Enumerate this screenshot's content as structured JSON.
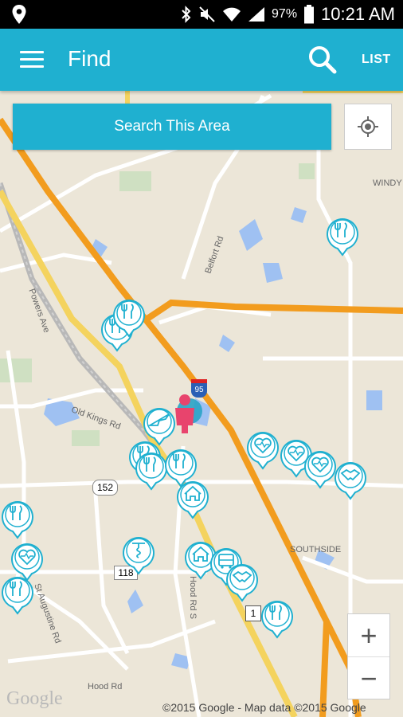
{
  "status_bar": {
    "battery": "97%",
    "time": "10:21 AM",
    "icons": [
      "location-icon",
      "bluetooth-icon",
      "mute-icon",
      "wifi-icon",
      "signal-icon",
      "battery-icon"
    ]
  },
  "app_bar": {
    "title": "Find",
    "list_label": "LIST",
    "color": "#1fb0d0"
  },
  "map": {
    "search_area_label": "Search This Area",
    "zoom_in": "+",
    "zoom_out": "−",
    "google_logo": "Google",
    "copyright": "©2015 Google - Map data ©2015 Google",
    "labels": {
      "windy": "WINDY",
      "belfort": "Belfort Rd",
      "powers": "Powers Ave",
      "old_kings": "Old Kings Rd",
      "southside": "SOUTHSIDE",
      "hood_rd": "Hood Rd S",
      "st_augustine": "St Augustine Rd",
      "hood_rd_bottom": "Hood Rd",
      "rt152": "152",
      "rt118": "118",
      "i95": "95",
      "us1": "1"
    },
    "pins": [
      {
        "type": "restaurant",
        "icon": "restaurant-icon"
      },
      {
        "type": "restaurant",
        "icon": "restaurant-icon"
      },
      {
        "type": "restaurant",
        "icon": "restaurant-icon"
      },
      {
        "type": "airport",
        "icon": "airplane-icon"
      },
      {
        "type": "restaurant",
        "icon": "restaurant-icon"
      },
      {
        "type": "restaurant",
        "icon": "restaurant-icon"
      },
      {
        "type": "restaurant",
        "icon": "restaurant-icon"
      },
      {
        "type": "home",
        "icon": "home-icon"
      },
      {
        "type": "health",
        "icon": "heart-health-icon"
      },
      {
        "type": "health",
        "icon": "heart-health-icon"
      },
      {
        "type": "health",
        "icon": "heart-health-icon"
      },
      {
        "type": "handshake",
        "icon": "handshake-icon"
      },
      {
        "type": "restaurant",
        "icon": "restaurant-icon"
      },
      {
        "type": "health",
        "icon": "heart-health-icon"
      },
      {
        "type": "restaurant",
        "icon": "restaurant-icon"
      },
      {
        "type": "wine",
        "icon": "corkscrew-icon"
      },
      {
        "type": "home",
        "icon": "home-icon"
      },
      {
        "type": "bus",
        "icon": "bus-icon"
      },
      {
        "type": "handshake",
        "icon": "handshake-icon"
      },
      {
        "type": "restaurant",
        "icon": "restaurant-icon"
      }
    ]
  }
}
